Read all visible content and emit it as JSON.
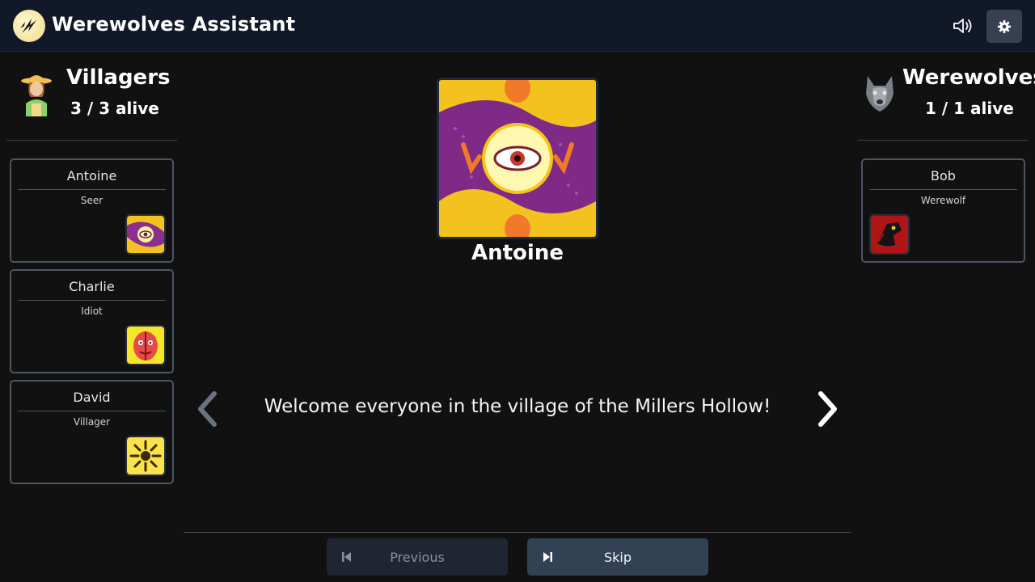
{
  "header": {
    "title": "Werewolves Assistant",
    "logo_icon": "werewolf-claw-logo-icon",
    "sound_icon": "speaker-icon",
    "settings_icon": "gear-icon"
  },
  "villagers": {
    "name": "Villagers",
    "alive": "3 / 3 alive",
    "players": [
      {
        "name": "Antoine",
        "role": "Seer",
        "icon": "seer-eye-icon"
      },
      {
        "name": "Charlie",
        "role": "Idiot",
        "icon": "idiot-face-icon"
      },
      {
        "name": "David",
        "role": "Villager",
        "icon": "villager-icon"
      }
    ]
  },
  "werewolves": {
    "name": "Werewolves",
    "alive": "1 / 1 alive",
    "players": [
      {
        "name": "Bob",
        "role": "Werewolf",
        "icon": "werewolf-icon"
      }
    ]
  },
  "current": {
    "player": "Antoine",
    "role_icon": "seer-eye-icon",
    "narration": "Welcome everyone in the village of the Millers Hollow!"
  },
  "footer": {
    "previous_label": "Previous",
    "skip_label": "Skip"
  },
  "colors": {
    "background": "#111111",
    "topbar": "#111827",
    "card_border": "#4b5563",
    "skip_button": "#334155",
    "previous_button": "#1f2532"
  }
}
